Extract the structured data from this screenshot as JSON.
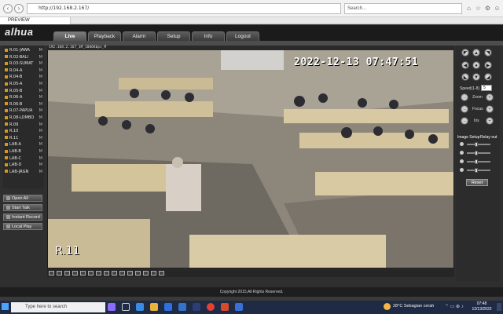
{
  "browser": {
    "url": "http://192.168.2.167/",
    "search_placeholder": "Search...",
    "tab_title": "PREVIEW"
  },
  "app": {
    "logo": "alhua",
    "nav": [
      {
        "label": "Live",
        "active": true
      },
      {
        "label": "Playback"
      },
      {
        "label": "Alarm"
      },
      {
        "label": "Setup"
      },
      {
        "label": "Info"
      },
      {
        "label": "Logout"
      }
    ],
    "channels": [
      "R.01-JAWA",
      "R.02-BALI",
      "R.03-SUMAT",
      "R.04-A",
      "R.04-B",
      "R.05-A",
      "R.05-B",
      "R.06-A",
      "R.06-B",
      "R.07-PAPUA",
      "R.08-LOMBO",
      "R.09",
      "R.10",
      "R.11",
      "LAB-A",
      "LAB-B",
      "LAB-C",
      "LAB-D",
      "LAB-JRGN"
    ],
    "channel_marker": "M",
    "left_buttons": [
      "Open All",
      "Start Talk",
      "Instant Record",
      "Local Play"
    ],
    "video_info": "192.168.2.167_1M_1066Kbps_M",
    "osd_time": "2022-12-13  07:47:51",
    "osd_name": "R.11",
    "ptz": {
      "speed_label": "Speed(1-8)",
      "speed_value": "5",
      "zoom_label": "Zoom",
      "focus_label": "Focus",
      "iris_label": "Iris"
    },
    "image_setup_label": "Image Setup",
    "relay_out_label": "Relay-out",
    "reset_label": "Reset",
    "footer": "Copyright 2015,All Rights Reserved."
  },
  "taskbar": {
    "search_placeholder": "Type here to search",
    "weather": "28°C  Sebagian cerah",
    "time": "07:48",
    "date": "12/13/2022"
  },
  "colors": {
    "accent_channel": "#d79a1c",
    "taskbar": "#1f2a44"
  }
}
